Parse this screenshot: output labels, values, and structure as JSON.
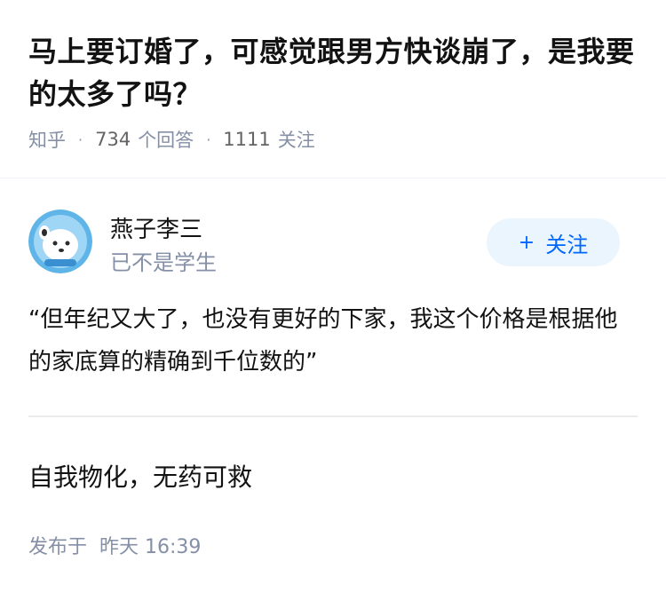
{
  "question": {
    "title": "马上要订婚了，可感觉跟男方快谈崩了，是我要的太多了吗？",
    "source": "知乎",
    "answer_count": "734",
    "answer_label": "个回答",
    "follower_count": "1111",
    "follower_label": "关注"
  },
  "author": {
    "name": "燕子李三",
    "headline": "已不是学生",
    "avatar_icon": "cartoon-avatar-icon",
    "follow_label": "关注",
    "follow_icon": "plus-icon"
  },
  "answer": {
    "quote": "“但年纪又大了，也没有更好的下家，我这个价格是根据他的家底算的精确到千位数的”",
    "body": "自我物化，无药可救",
    "publish_label": "发布于",
    "publish_time": "昨天 16:39"
  },
  "colors": {
    "title": "#121212",
    "meta": "#8590a6",
    "accent": "#0066ff",
    "follow_bg": "#ebf5fd",
    "divider": "#ebebeb"
  }
}
